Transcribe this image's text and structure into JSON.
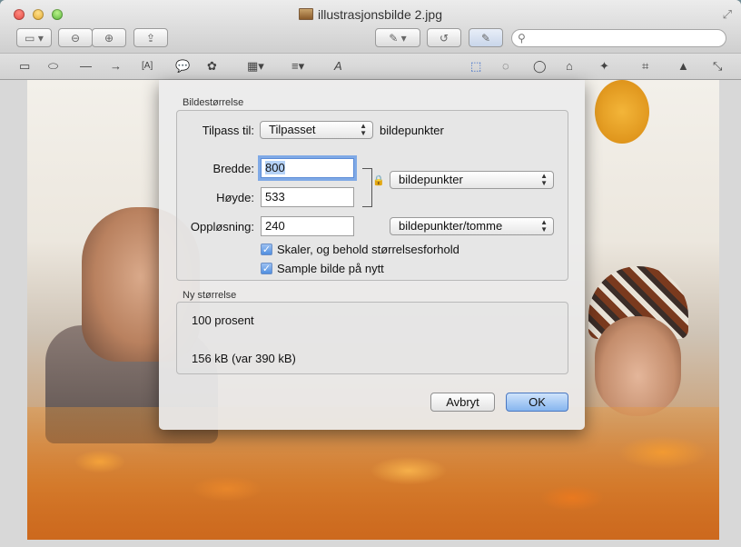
{
  "window": {
    "title": "illustrasjonsbilde 2.jpg"
  },
  "toolbar": {
    "search_placeholder": ""
  },
  "dialog": {
    "section_size": "Bildestørrelse",
    "fit_label": "Tilpass til:",
    "fit_value": "Tilpasset",
    "fit_unit": "bildepunkter",
    "width_label": "Bredde:",
    "width_value": "800",
    "height_label": "Høyde:",
    "height_value": "533",
    "size_unit": "bildepunkter",
    "resolution_label": "Oppløsning:",
    "resolution_value": "240",
    "resolution_unit": "bildepunkter/tomme",
    "scale_checkbox": "Skaler, og behold størrelsesforhold",
    "scale_checked": true,
    "resample_checkbox": "Sample bilde på nytt",
    "resample_checked": true,
    "section_new": "Ny størrelse",
    "new_percent": "100 prosent",
    "new_filesize": "156 kB (var 390 kB)",
    "cancel_label": "Avbryt",
    "ok_label": "OK"
  },
  "colors": {
    "accent": "#86b5ef",
    "focus_ring": "#7fa9e6"
  }
}
